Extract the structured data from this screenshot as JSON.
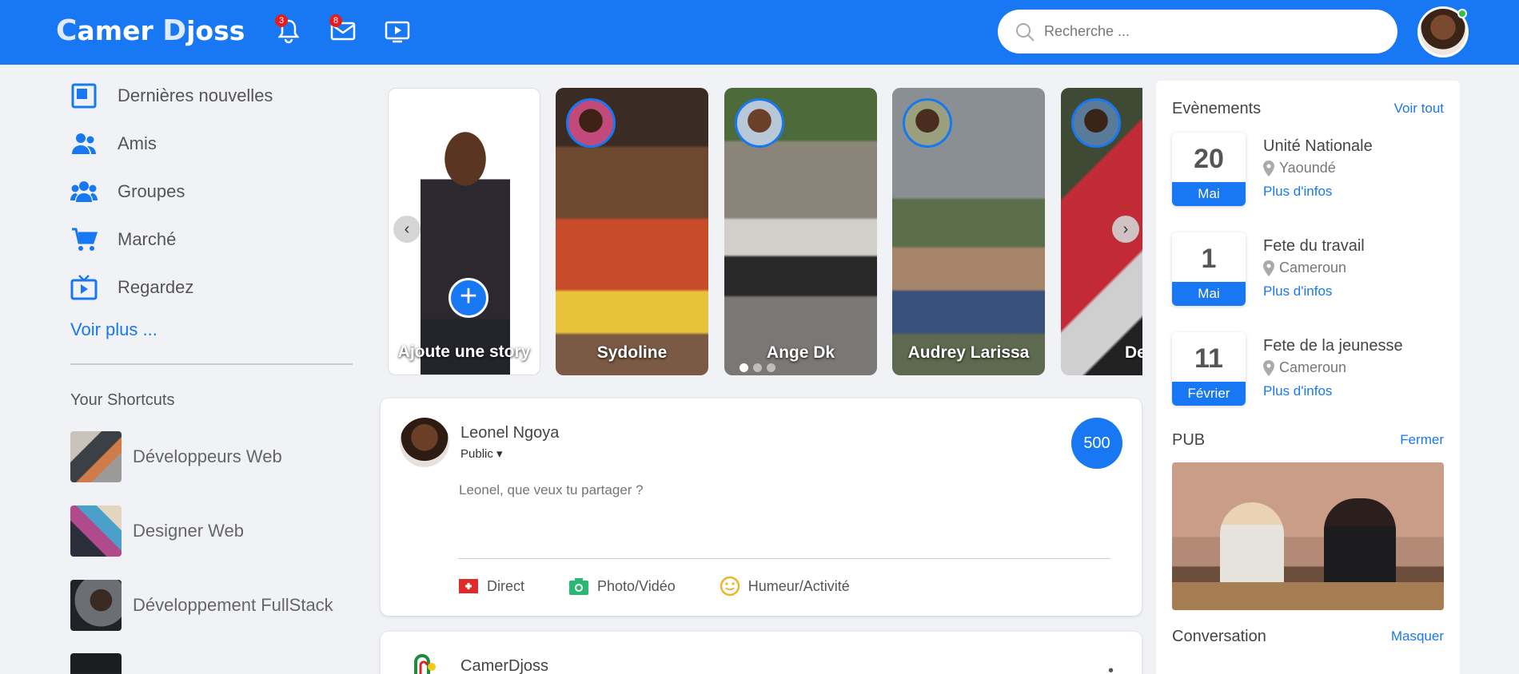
{
  "header": {
    "logo_first": "C",
    "logo_mid": "amer",
    "logo_second": "D",
    "logo_end": "joss",
    "notifications_count": "3",
    "messages_count": "8",
    "search_placeholder": "Recherche ...",
    "brand_color": "#1877f2"
  },
  "sidebar": {
    "items": [
      {
        "label": "Dernières nouvelles",
        "icon": "news-feed-icon"
      },
      {
        "label": "Amis",
        "icon": "friends-icon"
      },
      {
        "label": "Groupes",
        "icon": "groups-icon"
      },
      {
        "label": "Marché",
        "icon": "cart-icon"
      },
      {
        "label": "Regardez",
        "icon": "watch-icon"
      }
    ],
    "more_label": "Voir plus ...",
    "shortcuts_title": "Your Shortcuts",
    "shortcuts": [
      {
        "label": "Développeurs Web"
      },
      {
        "label": "Designer Web"
      },
      {
        "label": "Développement FullStack"
      },
      {
        "label": ""
      }
    ]
  },
  "stories": {
    "items": [
      {
        "name": "Ajoute une story"
      },
      {
        "name": "Sydoline"
      },
      {
        "name": "Ange Dk"
      },
      {
        "name": "Audrey Larissa"
      },
      {
        "name": "Der"
      }
    ]
  },
  "composer": {
    "user_name": "Leonel Ngoya",
    "privacy": "Public",
    "count": "500",
    "placeholder": "Leonel, que veux tu partager ?",
    "actions": [
      {
        "label": "Direct",
        "icon": "live-video-icon"
      },
      {
        "label": "Photo/Vidéo",
        "icon": "camera-icon"
      },
      {
        "label": "Humeur/Activité",
        "icon": "smiley-icon"
      }
    ]
  },
  "post": {
    "author": "CamerDjoss"
  },
  "events": {
    "title": "Evènements",
    "see_all": "Voir tout",
    "items": [
      {
        "day": "20",
        "month": "Mai",
        "title": "Unité Nationale",
        "location": "Yaoundé",
        "more": "Plus d'infos"
      },
      {
        "day": "1",
        "month": "Mai",
        "title": "Fete du travail",
        "location": "Cameroun",
        "more": "Plus d'infos"
      },
      {
        "day": "11",
        "month": "Février",
        "title": "Fete de la jeunesse",
        "location": "Cameroun",
        "more": "Plus d'infos"
      }
    ]
  },
  "pub": {
    "title": "PUB",
    "close": "Fermer"
  },
  "conversation": {
    "title": "Conversation",
    "hide": "Masquer"
  }
}
